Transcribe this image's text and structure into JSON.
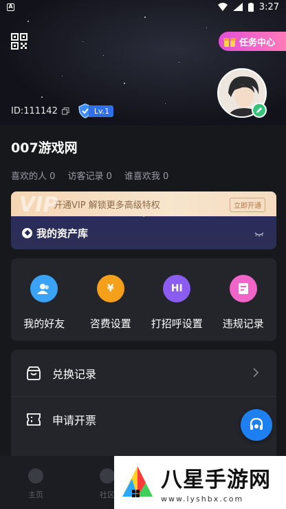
{
  "status_bar": {
    "time": "3:27"
  },
  "header": {
    "task_center_label": "任务中心",
    "user_id": "ID:111142",
    "level": "Lv.1"
  },
  "profile": {
    "username": "007游戏网",
    "stats": [
      {
        "label": "喜欢的人",
        "value": "0"
      },
      {
        "label": "访客记录",
        "value": "0"
      },
      {
        "label": "谁喜欢我",
        "value": "0"
      }
    ]
  },
  "vip": {
    "watermark": "VIP",
    "promo_text": "开通VIP 解锁更多高级特权",
    "open_label": "立即开通",
    "asset_label": "我的资产库"
  },
  "tools": [
    {
      "label": "我的好友",
      "icon": "friends-icon",
      "color": "#3aa3f5",
      "glyph": ""
    },
    {
      "label": "咨费设置",
      "icon": "yen-icon",
      "color": "#f5a01a",
      "glyph": "¥"
    },
    {
      "label": "打招呼设置",
      "icon": "hi-icon",
      "color": "#8b5cf0",
      "glyph": "HI"
    },
    {
      "label": "违规记录",
      "icon": "record-icon",
      "color": "#f065c8",
      "glyph": ""
    }
  ],
  "list": [
    {
      "label": "兑换记录",
      "icon": "redeem-icon"
    },
    {
      "label": "申请开票",
      "icon": "invoice-icon"
    }
  ],
  "tabbar": [
    {
      "label": "主页"
    },
    {
      "label": "社区"
    },
    {
      "label": ""
    },
    {
      "label": ""
    }
  ],
  "watermark": {
    "title": "八星手游网",
    "url": "www.lyshbx.com"
  },
  "colors": {
    "accent_blue": "#1e7ff0",
    "task_pink": "#e24fd6",
    "vip_gold": "#f5d6b3"
  }
}
